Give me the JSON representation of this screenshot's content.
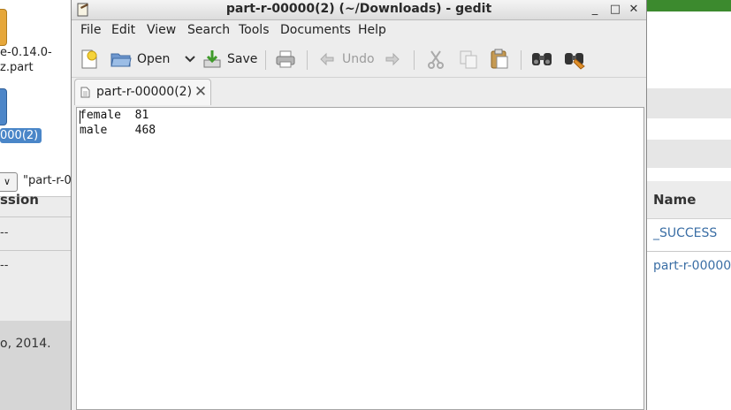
{
  "background": {
    "file_labels": {
      "file1_line1": "e-0.14.0-",
      "file1_line2": "z.part",
      "file2_selected": "000(2)"
    },
    "dropdown_glyph": "∨",
    "path_text": "\"part-r-0",
    "table": {
      "left_header": "ssion",
      "left_cells": [
        "--",
        "--"
      ],
      "right_header": "Name",
      "right_links": [
        "_SUCCESS",
        "part-r-00000"
      ]
    },
    "footer_text": "o, 2014."
  },
  "window": {
    "title": "part-r-00000(2) (~/Downloads) - gedit",
    "controls": {
      "minimize": "_",
      "maximize": "□",
      "close": "✕"
    },
    "menu": [
      "File",
      "Edit",
      "View",
      "Search",
      "Tools",
      "Documents",
      "Help"
    ],
    "toolbar": {
      "open_label": "Open",
      "save_label": "Save",
      "undo_label": "Undo",
      "icons": [
        "new-document-icon",
        "open-folder-icon",
        "dropdown-arrow-icon",
        "save-icon",
        "print-icon",
        "undo-icon",
        "redo-icon",
        "cut-icon",
        "copy-icon",
        "paste-icon",
        "find-icon",
        "find-replace-icon"
      ]
    },
    "tab": {
      "label": "part-r-00000(2)",
      "close_glyph": "✕"
    },
    "document_lines": [
      "female  81",
      "male    468"
    ]
  },
  "colors": {
    "selection_blue": "#4a86c8",
    "link_blue": "#3a6ea5",
    "green_bar": "#3c8a2e"
  }
}
